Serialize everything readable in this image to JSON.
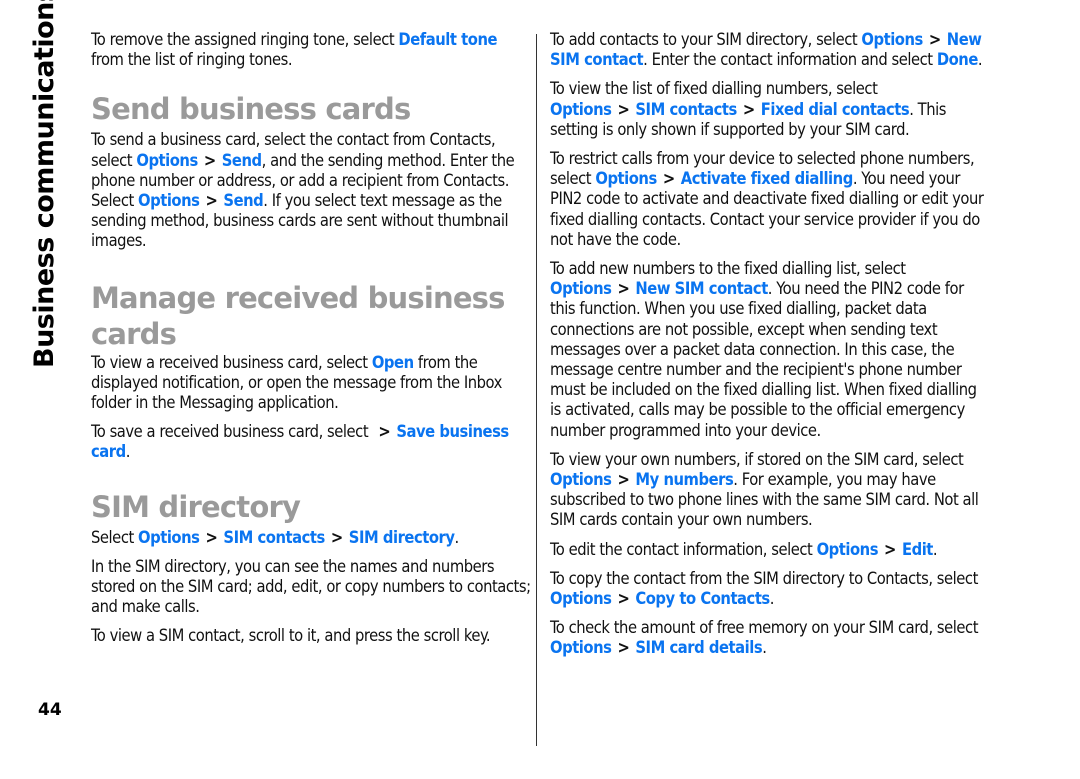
{
  "sidebar": {
    "section_title": "Business communications",
    "page_number": "44"
  },
  "colors": {
    "link": "#0a74f0",
    "heading": "#9a9a9a",
    "text": "#111111"
  },
  "left": {
    "p1": {
      "t1": "To remove the assigned ringing tone, select ",
      "l1": "Default tone",
      "t2": " from the list of ringing tones."
    },
    "h_send": "Send business cards",
    "p2": {
      "t1": "To send a business card, select the contact from Contacts, select ",
      "l1": "Options",
      "sep": ">",
      "l2": "Send",
      "t2": ", and the sending method. Enter the phone number or address, or add a recipient from Contacts. Select ",
      "l3": "Options",
      "l4": "Send",
      "t3": ". If you select text message as the sending method, business cards are sent without thumbnail images."
    },
    "h_manage": "Manage received business cards",
    "p3": {
      "t1": "To view a received business card, select ",
      "l1": "Open",
      "t2": " from the displayed notification, or open the message from the Inbox folder in the Messaging application."
    },
    "p4": {
      "t1": "To save a received business card, select ",
      "sep": ">",
      "l1": "Save business card",
      "t2": "."
    },
    "h_sim": "SIM directory",
    "p5": {
      "t1": "Select ",
      "l1": "Options",
      "sep": ">",
      "l2": "SIM contacts",
      "l3": "SIM directory",
      "t2": "."
    },
    "p6": "In the SIM directory, you can see the names and numbers stored on the SIM card; add, edit, or copy numbers to contacts; and make calls.",
    "p7": "To view a SIM contact, scroll to it, and press the scroll key."
  },
  "right": {
    "p1": {
      "t1": "To add contacts to your SIM directory, select ",
      "l1": "Options",
      "sep": ">",
      "l2": "New SIM contact",
      "t2": ". Enter the contact information and select ",
      "l3": "Done",
      "t3": "."
    },
    "p2": {
      "t1": "To view the list of fixed dialling numbers, select ",
      "l1": "Options",
      "sep": ">",
      "l2": "SIM contacts",
      "l3": "Fixed dial contacts",
      "t2": ". This setting is only shown if supported by your SIM card."
    },
    "p3": {
      "t1": "To restrict calls from your device to selected phone numbers, select ",
      "l1": "Options",
      "sep": ">",
      "l2": "Activate fixed dialling",
      "t2": ". You need your PIN2 code to activate and deactivate fixed dialling or edit your fixed dialling contacts. Contact your service provider if you do not have the code."
    },
    "p4": {
      "t1": "To add new numbers to the fixed dialling list, select ",
      "l1": "Options",
      "sep": ">",
      "l2": "New SIM contact",
      "t2": ". You need the PIN2 code for this function. When you use fixed dialling, packet data connections are not possible, except when sending text messages over a packet data connection. In this case, the message centre number and the recipient's phone number must be included on the fixed dialling list. When fixed dialling is activated, calls may be possible to the official emergency number programmed into your device."
    },
    "p5": {
      "t1": "To view your own numbers, if stored on the SIM card, select ",
      "l1": "Options",
      "sep": ">",
      "l2": "My numbers",
      "t2": ". For example, you may have subscribed to two phone lines with the same SIM card. Not all SIM cards contain your own numbers."
    },
    "p6": {
      "t1": "To edit the contact information, select ",
      "l1": "Options",
      "sep": ">",
      "l2": "Edit",
      "t2": "."
    },
    "p7": {
      "t1": "To copy the contact from the SIM directory to Contacts, select ",
      "l1": "Options",
      "sep": ">",
      "l2": "Copy to Contacts",
      "t2": "."
    },
    "p8": {
      "t1": "To check the amount of free memory on your SIM card, select ",
      "l1": "Options",
      "sep": ">",
      "l2": "SIM card details",
      "t2": "."
    }
  }
}
